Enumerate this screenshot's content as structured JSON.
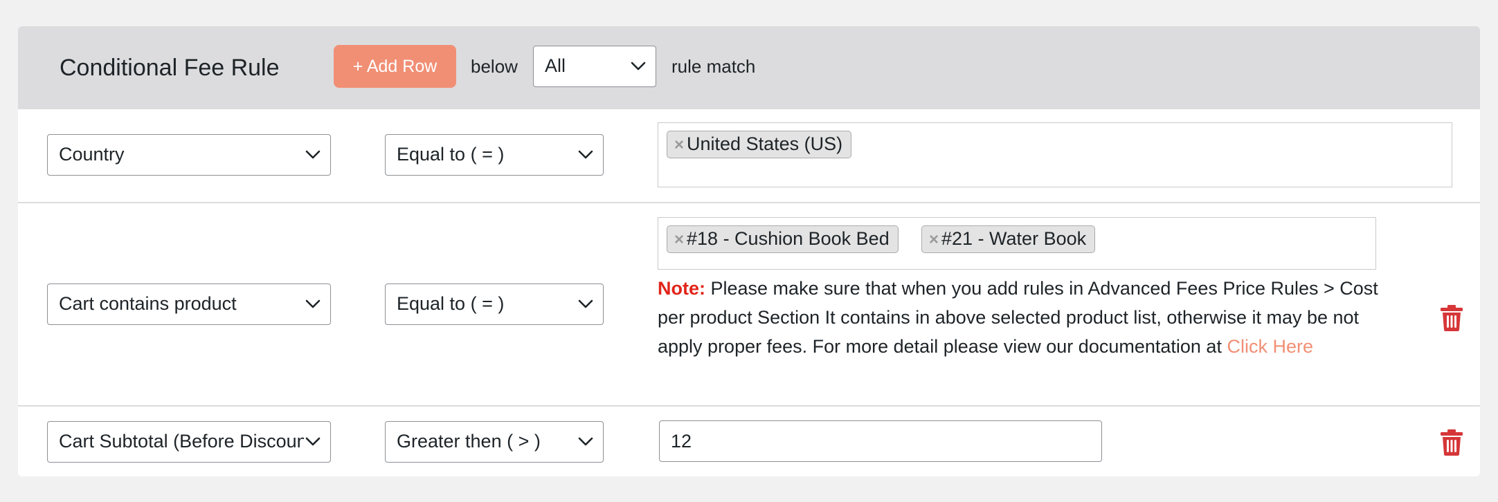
{
  "header": {
    "title": "Conditional Fee Rule",
    "add_row_label": "+ Add Row",
    "below_text": "below",
    "match_select": "All",
    "rule_match_text": "rule match"
  },
  "rules": [
    {
      "condition": "Country",
      "operator": "Equal to ( = )",
      "tags": [
        "United States (US)"
      ]
    },
    {
      "condition": "Cart contains product",
      "operator": "Equal to ( = )",
      "tags": [
        "#18 - Cushion Book Bed",
        "#21 - Water Book"
      ],
      "note_label": "Note:",
      "note_text": " Please make sure that when you add rules in Advanced Fees Price Rules > Cost per product Section It contains in above selected product list, otherwise it may be not apply proper fees. For more detail please view our documentation at ",
      "note_link": "Click Here"
    },
    {
      "condition": "Cart Subtotal (Before Discount)",
      "operator": "Greater then ( > )",
      "value": "12"
    }
  ],
  "colors": {
    "accent": "#f18f75",
    "danger": "#d63638",
    "header_bg": "#dcdcde"
  },
  "icons": {
    "chevron": "chevron-down-icon",
    "remove": "remove-tag-icon",
    "delete": "trash-icon"
  }
}
